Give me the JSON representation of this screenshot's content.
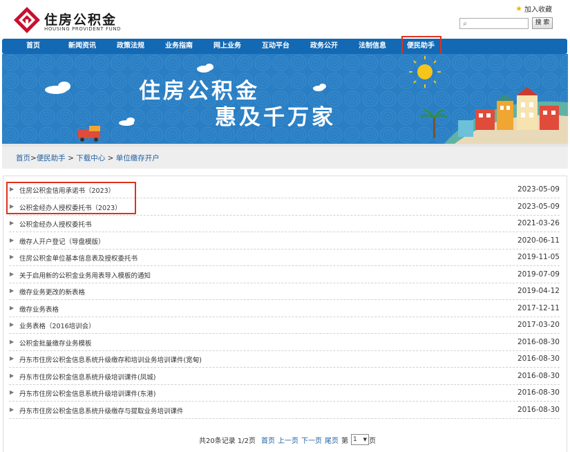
{
  "header": {
    "logo_cn": "住房公积金",
    "logo_en": "HOUSING PROVIDENT FUND",
    "favorite_label": "加入收藏",
    "search_placeholder": "",
    "search_button": "搜 索"
  },
  "nav": {
    "items": [
      "首页",
      "新闻资讯",
      "政策法规",
      "业务指南",
      "网上业务",
      "互动平台",
      "政务公开",
      "法制信息",
      "便民助手"
    ],
    "active": "便民助手"
  },
  "banner": {
    "line1": "住房公积金",
    "line2": "惠及千万家"
  },
  "breadcrumb": {
    "items": [
      "首页",
      "便民助手",
      "下载中心",
      "单位缴存开户"
    ],
    "separators": [
      ">",
      " > ",
      " > "
    ]
  },
  "list": {
    "items": [
      {
        "title": "住房公积金信用承诺书（2023）",
        "date": "2023-05-09"
      },
      {
        "title": "公积金经办人授权委托书（2023）",
        "date": "2023-05-09"
      },
      {
        "title": "公积金经办人授权委托书",
        "date": "2021-03-26"
      },
      {
        "title": "缴存人开户登记（导盘模版）",
        "date": "2020-06-11"
      },
      {
        "title": "住房公积金单位基本信息表及授权委托书",
        "date": "2019-11-05"
      },
      {
        "title": "关于启用新的公积金业务用表导入模板的通知",
        "date": "2019-07-09"
      },
      {
        "title": "缴存业务更改的新表格",
        "date": "2019-04-12"
      },
      {
        "title": "缴存业务表格",
        "date": "2017-12-11"
      },
      {
        "title": "业务表格（2016培训会）",
        "date": "2017-03-20"
      },
      {
        "title": "公积金批量缴存业务模板",
        "date": "2016-08-30"
      },
      {
        "title": "丹东市住房公积金信息系统升级缴存和培训业务培训课件(宽甸)",
        "date": "2016-08-30"
      },
      {
        "title": "丹东市住房公积金信息系统升级培训课件(凤城)",
        "date": "2016-08-30"
      },
      {
        "title": "丹东市住房公积金信息系统升级培训课件(东港)",
        "date": "2016-08-30"
      },
      {
        "title": "丹东市住房公积金信息系统升级缴存与提取业务培训课件",
        "date": "2016-08-30"
      }
    ]
  },
  "pager": {
    "summary": "共20条记录 1/2页",
    "first": "首页",
    "prev": "上一页",
    "next": "下一页",
    "last": "尾页",
    "goto_prefix": "第",
    "page_value": "1",
    "goto_suffix": "页"
  },
  "colors": {
    "nav_bg": "#1369b3",
    "highlight": "#e0301e",
    "link": "#1f5fa0",
    "logo_red": "#c8102e"
  }
}
